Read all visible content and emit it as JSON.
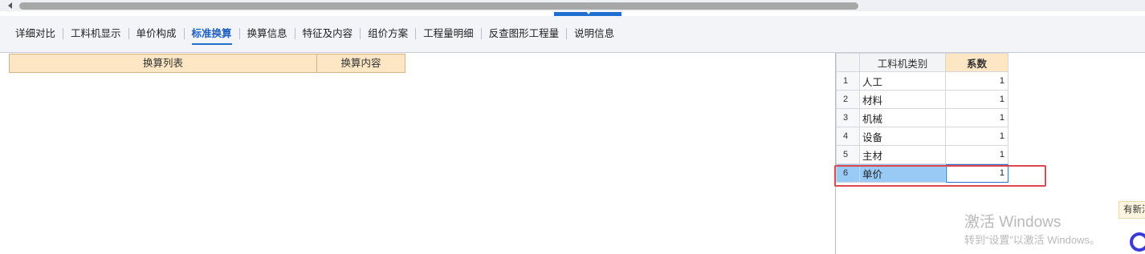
{
  "tabs": [
    {
      "label": "详细对比"
    },
    {
      "label": "工料机显示"
    },
    {
      "label": "单价构成"
    },
    {
      "label": "标准换算",
      "active": true
    },
    {
      "label": "换算信息"
    },
    {
      "label": "特征及内容"
    },
    {
      "label": "组价方案"
    },
    {
      "label": "工程量明细"
    },
    {
      "label": "反查图形工程量"
    },
    {
      "label": "说明信息"
    }
  ],
  "left_table": {
    "headers": [
      "换算列表",
      "换算内容"
    ]
  },
  "right_table": {
    "headers": [
      "",
      "工料机类别",
      "系数"
    ],
    "rows": [
      {
        "num": "1",
        "type": "人工",
        "coef": "1"
      },
      {
        "num": "2",
        "type": "材料",
        "coef": "1"
      },
      {
        "num": "3",
        "type": "机械",
        "coef": "1"
      },
      {
        "num": "4",
        "type": "设备",
        "coef": "1"
      },
      {
        "num": "5",
        "type": "主材",
        "coef": "1"
      },
      {
        "num": "6",
        "type": "单价",
        "coef": "1",
        "selected": true
      }
    ]
  },
  "watermark": {
    "title": "激活 Windows",
    "subtitle": "转到“设置”以激活 Windows。"
  },
  "notification": {
    "label": "有新消息"
  },
  "colors": {
    "accent": "#1f6fd1",
    "header_bg": "#fde6c4",
    "selection": "#99c9f5",
    "highlight_box": "#e0464e"
  }
}
